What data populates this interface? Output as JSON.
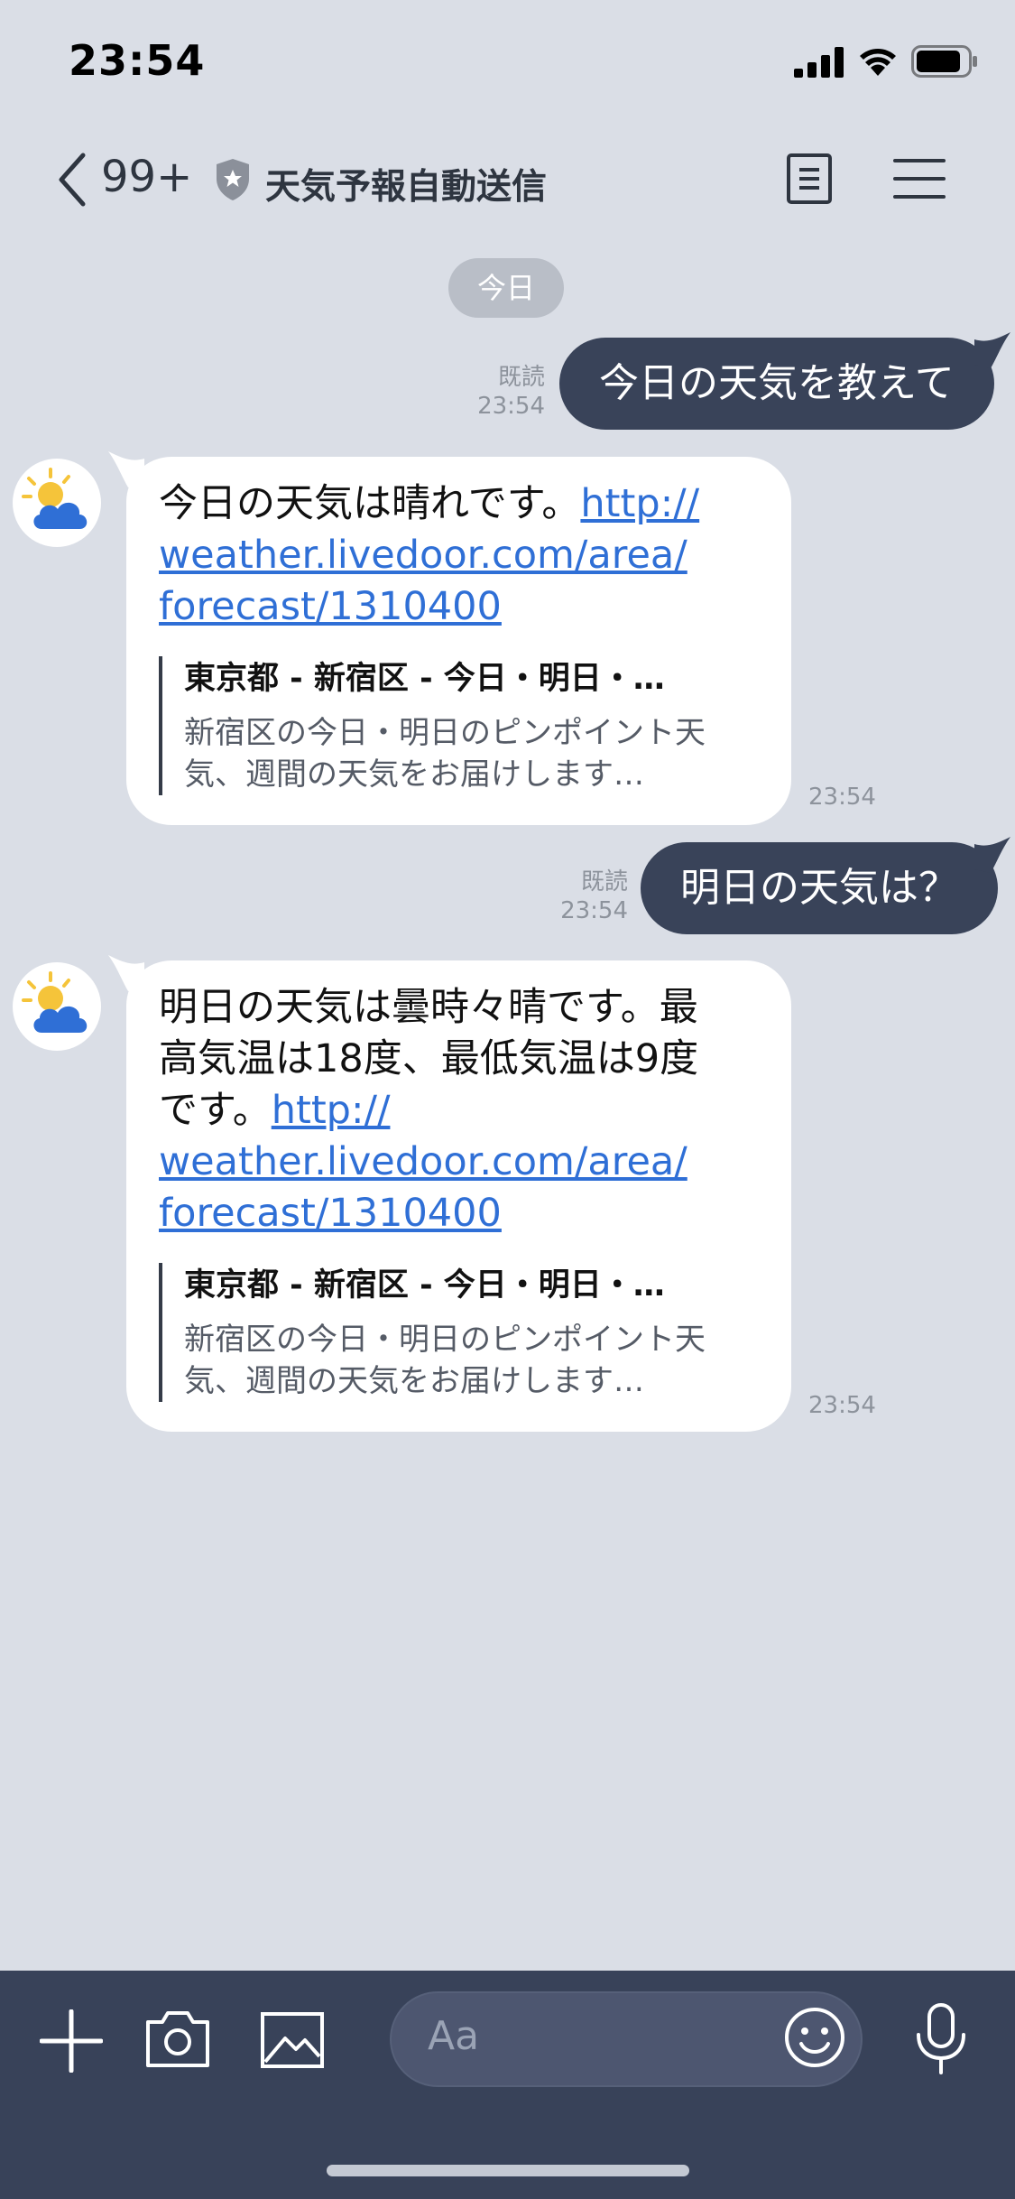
{
  "status": {
    "time": "23:54"
  },
  "header": {
    "unread_count": "99+",
    "title": "天気予報自動送信"
  },
  "date_label": "今日",
  "messages": [
    {
      "dir": "out",
      "read_label": "既読",
      "time": "23:54",
      "text": "今日の天気を教えて"
    },
    {
      "dir": "in",
      "text": "今日の天気は晴れです。",
      "link": "http://weather.livedoor.com/area/forecast/1310400",
      "link_lines": [
        "http://",
        "weather.livedoor.com/area/",
        "forecast/1310400"
      ],
      "preview": {
        "title": "東京都 - 新宿区 - 今日・明日・…",
        "desc": "新宿区の今日・明日のピンポイント天気、週間の天気をお届けします…"
      },
      "time": "23:54"
    },
    {
      "dir": "out",
      "read_label": "既読",
      "time": "23:54",
      "text": "明日の天気は？"
    },
    {
      "dir": "in",
      "text_lines": [
        "明日の天気は曇時々晴です。最",
        "高気温は18度、最低気温は9度",
        "です。"
      ],
      "link_lines": [
        "http://",
        "weather.livedoor.com/area/",
        "forecast/1310400"
      ],
      "preview": {
        "title": "東京都 - 新宿区 - 今日・明日・…",
        "desc": "新宿区の今日・明日のピンポイント天気、週間の天気をお届けします…"
      },
      "time": "23:54"
    }
  ],
  "composer": {
    "placeholder": "Aa"
  },
  "icons": [
    "back-chevron-icon",
    "shield-icon",
    "note-icon",
    "menu-icon",
    "weather-icon",
    "plus-icon",
    "camera-icon",
    "image-icon",
    "emoji-icon",
    "mic-icon"
  ]
}
